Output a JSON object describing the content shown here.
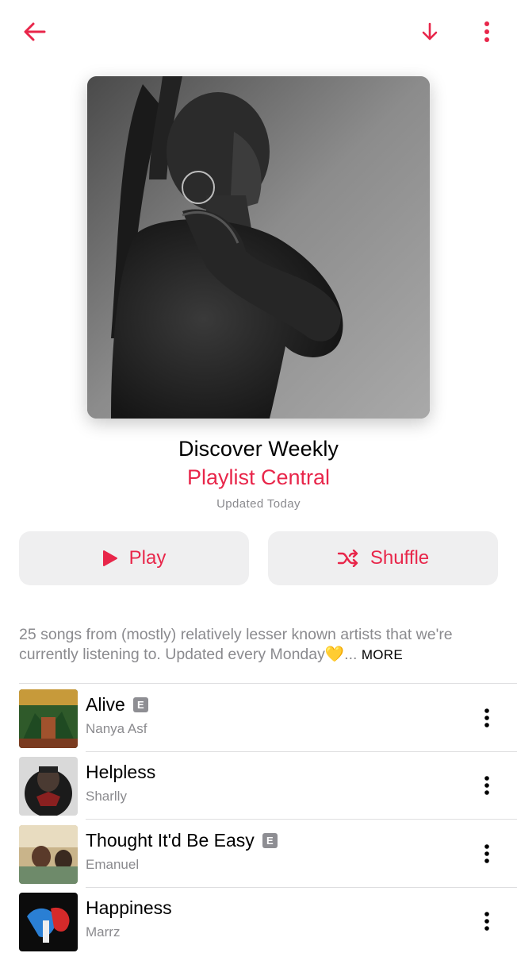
{
  "colors": {
    "accent": "#e8264a",
    "secondary_text": "#8a8a8e",
    "button_bg": "#efeff0",
    "explicit_badge": "#8e8e93"
  },
  "header": {
    "back_icon": "arrow-left-icon",
    "download_icon": "arrow-down-icon",
    "more_icon": "vertical-ellipsis-icon"
  },
  "playlist": {
    "title": "Discover Weekly",
    "curator": "Playlist Central",
    "updated": "Updated Today",
    "description": "25 songs from (mostly) relatively lesser known artists that we're currently listening to. Updated every Monday💛...",
    "more_label": "MORE"
  },
  "actions": {
    "play_label": "Play",
    "shuffle_label": "Shuffle"
  },
  "tracks": [
    {
      "title": "Alive",
      "artist": "Nanya Asf",
      "explicit": "E"
    },
    {
      "title": "Helpless",
      "artist": "Sharlly",
      "explicit": ""
    },
    {
      "title": "Thought It'd Be Easy",
      "artist": "Emanuel",
      "explicit": "E"
    },
    {
      "title": "Happiness",
      "artist": "Marrz",
      "explicit": ""
    }
  ]
}
